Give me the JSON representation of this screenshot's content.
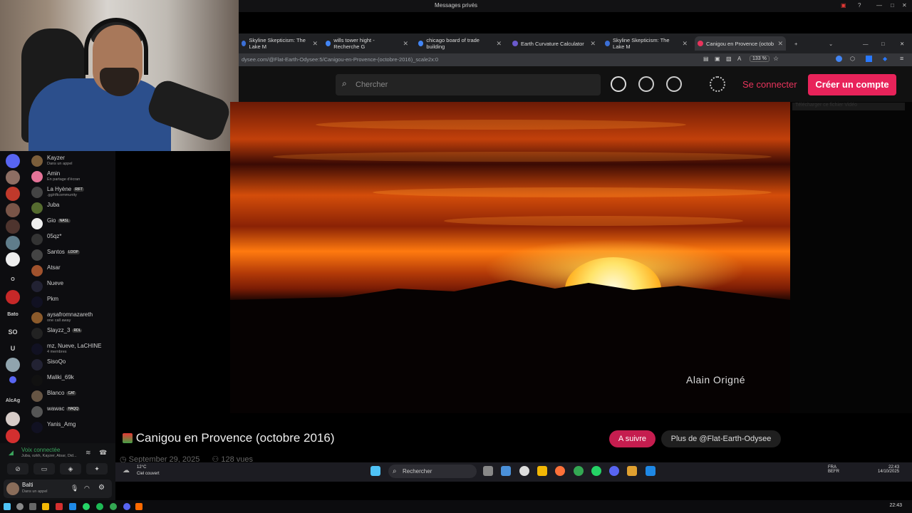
{
  "window": {
    "title": "Messages privés"
  },
  "tabs": [
    {
      "label": "Skyline Skepticism: The Lake M",
      "color": "#3b6fd6"
    },
    {
      "label": "wills tower hight - Recherche G",
      "color": "#4285f4"
    },
    {
      "label": "chicago board of trade building",
      "color": "#4285f4"
    },
    {
      "label": "Earth Curvature Calculator",
      "color": "#6a5acd"
    },
    {
      "label": "Skyline Skepticism: The Lake M",
      "color": "#3b6fd6"
    },
    {
      "label": "Canigou en Provence (octob",
      "color": "#e8345c"
    }
  ],
  "address": {
    "url": "dysee.com/@Flat-Earth-Odysee:5/Canigou-en-Provence-(octobre-2016)_scale2x:0",
    "zoom": "133 %"
  },
  "odysee": {
    "search_placeholder": "Chercher",
    "login": "Se connecter",
    "signup": "Créer un compte",
    "download_bar": "Télécharger ce fichier Vidéo"
  },
  "video": {
    "credit": "Alain Origné",
    "title": "Canigou en Provence (octobre 2016)",
    "date": "September 29, 2025",
    "views": "128 vues",
    "follow": "A suivre",
    "more": "Plus de @Flat-Earth-Odysee"
  },
  "servers": [
    {
      "color": "#5865f2",
      "text": ""
    },
    {
      "color": "#8d6e63",
      "text": ""
    },
    {
      "color": "#c0392b",
      "text": ""
    },
    {
      "color": "#795548",
      "text": ""
    },
    {
      "color": "#4e342e",
      "text": ""
    },
    {
      "color": "#607d8b",
      "text": ""
    },
    {
      "color": "#eeeeee",
      "text": ""
    },
    {
      "color": "",
      "text": "O"
    },
    {
      "color": "#c62828",
      "text": ""
    },
    {
      "color": "",
      "text": "Bato"
    },
    {
      "color": "",
      "text": "SO"
    },
    {
      "color": "",
      "text": "U"
    },
    {
      "color": "#90a4ae",
      "text": ""
    },
    {
      "color": "#5865f2",
      "text": ""
    },
    {
      "color": "",
      "text": "AlcAg"
    },
    {
      "color": "#d7ccc8",
      "text": ""
    },
    {
      "color": "#d32f2f",
      "text": ""
    }
  ],
  "dms": [
    {
      "name": "Kayzer",
      "sub": "Dans un appel",
      "badge": "",
      "color": "#7b5e3b"
    },
    {
      "name": "Amin",
      "sub": "En partage d'écran",
      "badge": "",
      "color": "#e57398"
    },
    {
      "name": "La Hyène",
      "sub": ".gg/riftcommunity",
      "badge": "RIFT",
      "color": "#444"
    },
    {
      "name": "Juba",
      "sub": "",
      "badge": "",
      "color": "#556b2f"
    },
    {
      "name": "Gio",
      "sub": "",
      "badge": "NASL",
      "color": "#eee"
    },
    {
      "name": "05qz*",
      "sub": "",
      "badge": "",
      "color": "#333"
    },
    {
      "name": "Santos",
      "sub": "",
      "badge": "LOOP",
      "color": "#444"
    },
    {
      "name": "Atsar",
      "sub": "",
      "badge": "",
      "color": "#a0522d"
    },
    {
      "name": "Nueve",
      "sub": "",
      "badge": "",
      "color": "#223"
    },
    {
      "name": "Pkm",
      "sub": "",
      "badge": "",
      "color": "#112"
    },
    {
      "name": "aysafromnazareth",
      "sub": "one call away",
      "badge": "",
      "color": "#8b5a2b"
    },
    {
      "name": "Slayzz_3",
      "sub": "",
      "badge": "RDL",
      "color": "#222"
    },
    {
      "name": "mz, Nueve, LaCHINE",
      "sub": "4 membres",
      "badge": "",
      "color": "#112"
    },
    {
      "name": "SisoQo",
      "sub": "",
      "badge": "",
      "color": "#223"
    },
    {
      "name": "Maliki_69k",
      "sub": "",
      "badge": "",
      "color": "#111"
    },
    {
      "name": "Blanco",
      "sub": "",
      "badge": "CAT",
      "color": "#654"
    },
    {
      "name": "wawac",
      "sub": "",
      "badge": "HAQQ",
      "color": "#555"
    },
    {
      "name": "Yanis_Amg",
      "sub": "",
      "badge": "",
      "color": "#112"
    }
  ],
  "voice": {
    "status": "Voix connectée",
    "members": "Juba, ozkh, Kayzer, Atsar, Did...",
    "user": "Balti",
    "user_status": "Dans un appel"
  },
  "inner_taskbar": {
    "weather_temp": "12°C",
    "weather_desc": "Ciel couvert",
    "search": "Rechercher",
    "lang": "FRA",
    "lang2": "BEFR",
    "time": "22:43",
    "date": "14/10/2025"
  },
  "outer_taskbar": {
    "time": "22:43"
  }
}
